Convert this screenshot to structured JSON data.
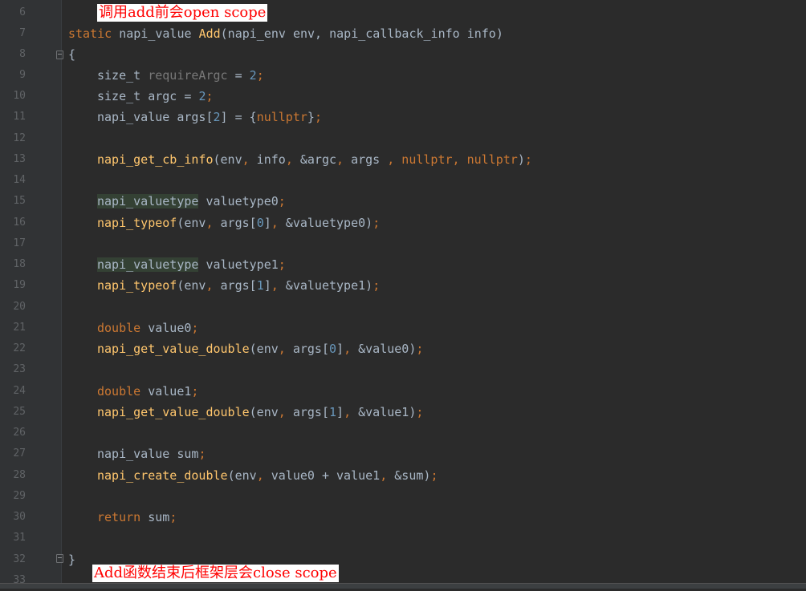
{
  "line_numbers": [
    "6",
    "7",
    "8",
    "9",
    "10",
    "11",
    "12",
    "13",
    "14",
    "15",
    "16",
    "17",
    "18",
    "19",
    "20",
    "21",
    "22",
    "23",
    "24",
    "25",
    "26",
    "27",
    "28",
    "29",
    "30",
    "31",
    "32",
    "33"
  ],
  "annotations": {
    "top": "调用add前会open scope",
    "bottom": "Add函数结束后框架层会close scope"
  },
  "code": {
    "l7": {
      "kw": "static",
      "t1": " napi_value ",
      "fn": "Add",
      "t2": "(napi_env env, napi_callback_info info)"
    },
    "l8": {
      "t": "{"
    },
    "l9": {
      "t1": "size_t ",
      "dim": "requireArgc",
      "t2": " = ",
      "num": "2",
      "semi": ";"
    },
    "l10": {
      "t1": "size_t argc = ",
      "num": "2",
      "semi": ";"
    },
    "l11": {
      "t1": "napi_value args[",
      "num": "2",
      "t2": "] = {",
      "kw": "nullptr",
      "t3": "}",
      "semi": ";"
    },
    "l13": {
      "fn": "napi_get_cb_info",
      "t1": "(env",
      "c1": ",",
      "t2": " info",
      "c2": ",",
      "t3": " &argc",
      "c3": ",",
      "t4": " args ",
      "c4": ",",
      "kw1": " nullptr",
      "c5": ",",
      "kw2": " nullptr",
      "t5": ")",
      "semi": ";"
    },
    "l15": {
      "hl": "napi_valuetype",
      "t1": " valuetype0",
      "semi": ";"
    },
    "l16": {
      "fn": "napi_typeof",
      "t1": "(env",
      "c1": ",",
      "t2": " args[",
      "num": "0",
      "t3": "]",
      "c2": ",",
      "t4": " &valuetype0)",
      "semi": ";"
    },
    "l18": {
      "hl": "napi_valuetype",
      "t1": " valuetype1",
      "semi": ";"
    },
    "l19": {
      "fn": "napi_typeof",
      "t1": "(env",
      "c1": ",",
      "t2": " args[",
      "num": "1",
      "t3": "]",
      "c2": ",",
      "t4": " &valuetype1)",
      "semi": ";"
    },
    "l21": {
      "kw": "double",
      "t1": " value0",
      "semi": ";"
    },
    "l22": {
      "fn": "napi_get_value_double",
      "t1": "(env",
      "c1": ",",
      "t2": " args[",
      "num": "0",
      "t3": "]",
      "c2": ",",
      "t4": " &value0)",
      "semi": ";"
    },
    "l24": {
      "kw": "double",
      "t1": " value1",
      "semi": ";"
    },
    "l25": {
      "fn": "napi_get_value_double",
      "t1": "(env",
      "c1": ",",
      "t2": " args[",
      "num": "1",
      "t3": "]",
      "c2": ",",
      "t4": " &value1)",
      "semi": ";"
    },
    "l27": {
      "t1": "napi_value sum",
      "semi": ";"
    },
    "l28": {
      "fn": "napi_create_double",
      "t1": "(env",
      "c1": ",",
      "t2": " value0 + value1",
      "c2": ",",
      "t3": " &sum)",
      "semi": ";"
    },
    "l30": {
      "kw": "return",
      "t1": " sum",
      "semi": ";"
    },
    "l32": {
      "t": "}"
    }
  }
}
